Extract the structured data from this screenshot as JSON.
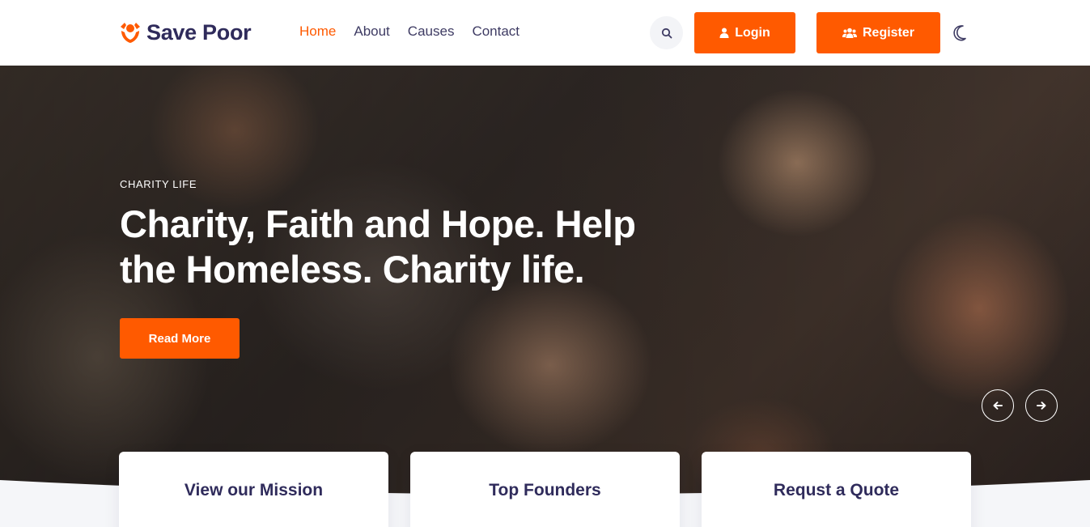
{
  "brand": {
    "name": "Save Poor",
    "accent": "#ff5a00",
    "ink": "#2f2b5b"
  },
  "nav": {
    "items": [
      {
        "label": "Home",
        "active": true
      },
      {
        "label": "About",
        "active": false
      },
      {
        "label": "Causes",
        "active": false
      },
      {
        "label": "Contact",
        "active": false
      }
    ]
  },
  "header_actions": {
    "search_icon": "search-icon",
    "login_label": "Login",
    "login_icon": "user-icon",
    "register_label": "Register",
    "register_icon": "users-icon",
    "theme_icon": "moon-icon"
  },
  "hero": {
    "eyebrow": "CHARITY LIFE",
    "title_line1": "Charity, Faith and Hope. Help",
    "title_line2": "the Homeless. Charity life.",
    "cta_label": "Read More",
    "prev_icon": "arrow-left-icon",
    "next_icon": "arrow-right-icon"
  },
  "cards": [
    {
      "title": "View our Mission"
    },
    {
      "title": "Top Founders"
    },
    {
      "title": "Requst a Quote"
    }
  ]
}
